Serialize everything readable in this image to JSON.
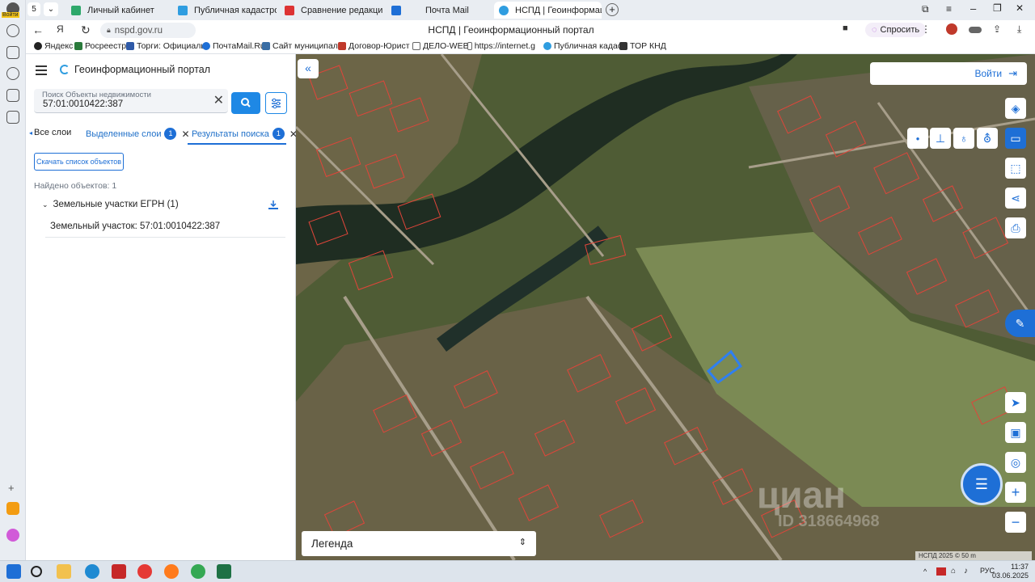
{
  "browser": {
    "profile_label": "Войти",
    "tabs": [
      {
        "label": "Личный кабинет",
        "active": false
      },
      {
        "label": "Публичная кадастровая ка",
        "active": false
      },
      {
        "label": "Сравнение редакций: Зем",
        "active": false
      },
      {
        "label": "Почта Mail",
        "active": false
      },
      {
        "label": "НСПД | Геоинформационн",
        "active": true
      }
    ],
    "url": "nspd.gov.ru",
    "page_title": "НСПД | Геоинформационный портал",
    "ask_label": "Спросить",
    "bookmarks": [
      "Яндекс",
      "Росреестр",
      "Торги: Официаль",
      "ПочтаMail.Ru",
      "Сайт муниципаль",
      "Договор-Юрист",
      "ДЕЛО-WEB",
      "https://internet.g",
      "Публичная кадас",
      "ТОР КНД"
    ]
  },
  "panel": {
    "title": "Геоинформационный портал",
    "search": {
      "label": "Поиск Объекты недвижимости",
      "value": "57:01:0010422:387"
    },
    "tabs": {
      "all_layers": "Все слои",
      "selected_layers": "Выделенные слои",
      "selected_count": "1",
      "results": "Результаты поиска",
      "results_count": "1"
    },
    "download_button": "Скачать список объектов",
    "found": "Найдено объектов: 1",
    "group": "Земельные участки ЕГРН (1)",
    "item": "Земельный участок: 57:01:0010422:387"
  },
  "map": {
    "login_label": "Войти",
    "legend_label": "Легенда",
    "scale_text": "НСПД 2025 ©        50 m",
    "watermark": "циан",
    "watermark_id": "ID 318664968"
  },
  "taskbar": {
    "lang": "РУС",
    "time": "11:37",
    "date": "03.06.2025"
  },
  "colors": {
    "accent": "#1e6fd6",
    "parcel_outline": "#e0453a",
    "selection": "#2f7ff0"
  }
}
